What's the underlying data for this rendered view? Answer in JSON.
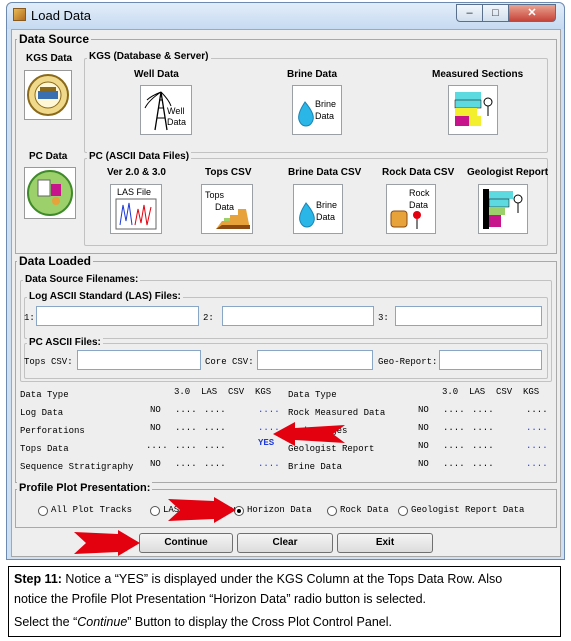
{
  "window": {
    "title": "Load Data",
    "minimize": "–",
    "maximize": "□",
    "close": "✕"
  },
  "data_source": {
    "title": "Data Source",
    "kgs_label": "KGS Data",
    "kgs_group": "KGS (Database & Server)",
    "kgs_items": [
      {
        "label": "Well Data",
        "icon_text": "Well\nData",
        "icon": "well-derrick-icon"
      },
      {
        "label": "Brine Data",
        "icon_text": "Brine\nData",
        "icon": "water-drop-icon"
      },
      {
        "label": "Measured Sections",
        "icon_text": "",
        "icon": "measured-section-icon"
      }
    ],
    "pc_label": "PC Data",
    "pc_group": "PC (ASCII Data Files)",
    "pc_items": [
      {
        "label": "Ver 2.0 & 3.0",
        "icon_text": "LAS File",
        "icon": "las-file-icon"
      },
      {
        "label": "Tops CSV",
        "icon_text": "Tops\nData",
        "icon": "tops-stairs-icon"
      },
      {
        "label": "Brine Data CSV",
        "icon_text": "Brine\nData",
        "icon": "water-drop-icon"
      },
      {
        "label": "Rock Data CSV",
        "icon_text": "Rock\nData",
        "icon": "rock-core-icon"
      },
      {
        "label": "Geologist Report",
        "icon_text": "",
        "icon": "geologist-report-icon"
      }
    ]
  },
  "data_loaded": {
    "title": "Data Loaded",
    "filenames_group": "Data Source Filenames:",
    "las_group": "Log ASCII Standard (LAS) Files:",
    "las_fields": [
      {
        "label": "1:",
        "value": ""
      },
      {
        "label": "2:",
        "value": ""
      },
      {
        "label": "3:",
        "value": ""
      }
    ],
    "pc_group": "PC ASCII Files:",
    "pc_fields": [
      {
        "label": "Tops CSV:",
        "value": ""
      },
      {
        "label": "Core CSV:",
        "value": ""
      },
      {
        "label": "Geo-Report:",
        "value": ""
      }
    ],
    "columns": [
      "Data Type",
      "3.0",
      "LAS",
      "CSV",
      "KGS"
    ],
    "left_rows": [
      {
        "type": "Log Data",
        "v30": "NO",
        "las": "....",
        "csv": "....",
        "kgs": "...."
      },
      {
        "type": "Perforations",
        "v30": "NO",
        "las": "....",
        "csv": "....",
        "kgs": "...."
      },
      {
        "type": "Tops Data",
        "v30": "....",
        "las": "....",
        "csv": "....",
        "kgs": "YES"
      },
      {
        "type": "Sequence Stratigraphy",
        "v30": "NO",
        "las": "....",
        "csv": "....",
        "kgs": "...."
      }
    ],
    "right_rows": [
      {
        "type": "Rock Measured Data",
        "v30": "NO",
        "las": "....",
        "csv": "....",
        "kgs": "...."
      },
      {
        "type": "Rock Images",
        "v30": "NO",
        "las": "....",
        "csv": "....",
        "kgs": "...."
      },
      {
        "type": "Geologist Report",
        "v30": "NO",
        "las": "....",
        "csv": "....",
        "kgs": "...."
      },
      {
        "type": "Brine Data",
        "v30": "NO",
        "las": "....",
        "csv": "....",
        "kgs": "...."
      }
    ]
  },
  "presentation": {
    "title": "Profile Plot Presentation:",
    "options": [
      {
        "label": "All Plot Tracks",
        "selected": false
      },
      {
        "label": "LAS 3.0 Presentation",
        "selected": false
      },
      {
        "label": "Horizon Data",
        "selected": true
      },
      {
        "label": "Rock Data",
        "selected": false
      },
      {
        "label": "Geologist Report Data",
        "selected": false
      }
    ]
  },
  "buttons": {
    "continue": "Continue",
    "clear": "Clear",
    "exit": "Exit"
  },
  "note": {
    "line1_bold": "Step 11:",
    "line1": " Notice a “YES”  is displayed under the KGS Column at the Tops Data Row.  Also",
    "line2": "notice the Profile Plot  Presentation “Horizon Data” radio button is selected.",
    "line3_a": "Select the “",
    "line3_em": "Continue",
    "line3_b": "” Button to display the Cross Plot Control Panel."
  },
  "colors": {
    "highlight_yes": "#1f3ad6",
    "arrow_red": "#e3000f",
    "title_bar": "#c6daf1"
  }
}
